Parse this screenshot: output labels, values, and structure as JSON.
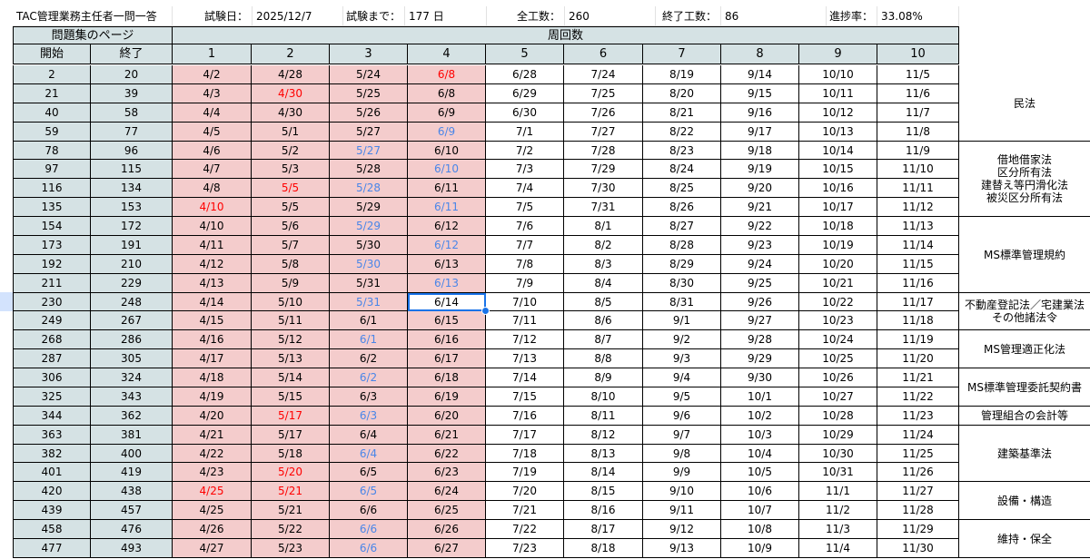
{
  "sheet_title": "TAC管理業務主任者一問一答",
  "summary": {
    "exam_date_label": "試験日：",
    "exam_date": "2025/12/7",
    "until_label": "試験まで：",
    "until_value": "177 日",
    "total_label": "全工数：",
    "total_value": "260",
    "done_label": "終了工数：",
    "done_value": "86",
    "progress_label": "進捗率：",
    "progress_value": "33.08%"
  },
  "headers": {
    "pages_group": "問題集のページ",
    "rounds_group": "周回数",
    "start": "開始",
    "end": "終了",
    "rounds": [
      "1",
      "2",
      "3",
      "4",
      "5",
      "6",
      "7",
      "8",
      "9",
      "10"
    ]
  },
  "rows": [
    {
      "pages": [
        "2",
        "20"
      ],
      "dates": [
        "4/2",
        "4/28",
        "5/24",
        "6/8",
        "6/28",
        "7/24",
        "8/19",
        "9/14",
        "10/10",
        "11/5"
      ],
      "colors": [
        "",
        "",
        "",
        "r",
        "",
        "",
        "",
        "",
        "",
        ""
      ]
    },
    {
      "pages": [
        "21",
        "39"
      ],
      "dates": [
        "4/3",
        "4/30",
        "5/25",
        "6/8",
        "6/29",
        "7/25",
        "8/20",
        "9/15",
        "10/11",
        "11/6"
      ],
      "colors": [
        "",
        "r",
        "",
        "",
        "",
        "",
        "",
        "",
        "",
        ""
      ]
    },
    {
      "pages": [
        "40",
        "58"
      ],
      "dates": [
        "4/4",
        "4/30",
        "5/26",
        "6/9",
        "6/30",
        "7/26",
        "8/21",
        "9/16",
        "10/12",
        "11/7"
      ],
      "colors": [
        "",
        "",
        "",
        "",
        "",
        "",
        "",
        "",
        "",
        ""
      ]
    },
    {
      "pages": [
        "59",
        "77"
      ],
      "dates": [
        "4/5",
        "5/1",
        "5/27",
        "6/9",
        "7/1",
        "7/27",
        "8/22",
        "9/17",
        "10/13",
        "11/8"
      ],
      "colors": [
        "",
        "",
        "",
        "b",
        "",
        "",
        "",
        "",
        "",
        ""
      ]
    },
    {
      "pages": [
        "78",
        "96"
      ],
      "dates": [
        "4/6",
        "5/2",
        "5/27",
        "6/10",
        "7/2",
        "7/28",
        "8/23",
        "9/18",
        "10/14",
        "11/9"
      ],
      "colors": [
        "",
        "",
        "b",
        "",
        "",
        "",
        "",
        "",
        "",
        ""
      ]
    },
    {
      "pages": [
        "97",
        "115"
      ],
      "dates": [
        "4/7",
        "5/3",
        "5/28",
        "6/10",
        "7/3",
        "7/29",
        "8/24",
        "9/19",
        "10/15",
        "11/10"
      ],
      "colors": [
        "",
        "",
        "",
        "b",
        "",
        "",
        "",
        "",
        "",
        ""
      ]
    },
    {
      "pages": [
        "116",
        "134"
      ],
      "dates": [
        "4/8",
        "5/5",
        "5/28",
        "6/11",
        "7/4",
        "7/30",
        "8/25",
        "9/20",
        "10/16",
        "11/11"
      ],
      "colors": [
        "",
        "r",
        "b",
        "",
        "",
        "",
        "",
        "",
        "",
        ""
      ]
    },
    {
      "pages": [
        "135",
        "153"
      ],
      "dates": [
        "4/10",
        "5/5",
        "5/29",
        "6/11",
        "7/5",
        "7/31",
        "8/26",
        "9/21",
        "10/17",
        "11/12"
      ],
      "colors": [
        "r",
        "",
        "",
        "b",
        "",
        "",
        "",
        "",
        "",
        ""
      ]
    },
    {
      "pages": [
        "154",
        "172"
      ],
      "dates": [
        "4/10",
        "5/6",
        "5/29",
        "6/12",
        "7/6",
        "8/1",
        "8/27",
        "9/22",
        "10/18",
        "11/13"
      ],
      "colors": [
        "",
        "",
        "b",
        "",
        "",
        "",
        "",
        "",
        "",
        ""
      ]
    },
    {
      "pages": [
        "173",
        "191"
      ],
      "dates": [
        "4/11",
        "5/7",
        "5/30",
        "6/12",
        "7/7",
        "8/2",
        "8/28",
        "9/23",
        "10/19",
        "11/14"
      ],
      "colors": [
        "",
        "",
        "",
        "b",
        "",
        "",
        "",
        "",
        "",
        ""
      ]
    },
    {
      "pages": [
        "192",
        "210"
      ],
      "dates": [
        "4/12",
        "5/8",
        "5/30",
        "6/13",
        "7/8",
        "8/3",
        "8/29",
        "9/24",
        "10/20",
        "11/15"
      ],
      "colors": [
        "",
        "",
        "b",
        "",
        "",
        "",
        "",
        "",
        "",
        ""
      ]
    },
    {
      "pages": [
        "211",
        "229"
      ],
      "dates": [
        "4/13",
        "5/9",
        "5/31",
        "6/13",
        "7/9",
        "8/4",
        "8/30",
        "9/25",
        "10/21",
        "11/16"
      ],
      "colors": [
        "",
        "",
        "",
        "b",
        "",
        "",
        "",
        "",
        "",
        ""
      ]
    },
    {
      "pages": [
        "230",
        "248"
      ],
      "dates": [
        "4/14",
        "5/10",
        "5/31",
        "6/14",
        "7/10",
        "8/5",
        "8/31",
        "9/26",
        "10/22",
        "11/17"
      ],
      "colors": [
        "",
        "",
        "b",
        "",
        "",
        "",
        "",
        "",
        "",
        ""
      ]
    },
    {
      "pages": [
        "249",
        "267"
      ],
      "dates": [
        "4/15",
        "5/11",
        "6/1",
        "6/15",
        "7/11",
        "8/6",
        "9/1",
        "9/27",
        "10/23",
        "11/18"
      ],
      "colors": [
        "",
        "",
        "",
        "",
        "",
        "",
        "",
        "",
        "",
        ""
      ]
    },
    {
      "pages": [
        "268",
        "286"
      ],
      "dates": [
        "4/16",
        "5/12",
        "6/1",
        "6/16",
        "7/12",
        "8/7",
        "9/2",
        "9/28",
        "10/24",
        "11/19"
      ],
      "colors": [
        "",
        "",
        "b",
        "",
        "",
        "",
        "",
        "",
        "",
        ""
      ]
    },
    {
      "pages": [
        "287",
        "305"
      ],
      "dates": [
        "4/17",
        "5/13",
        "6/2",
        "6/17",
        "7/13",
        "8/8",
        "9/3",
        "9/29",
        "10/25",
        "11/20"
      ],
      "colors": [
        "",
        "",
        "",
        "",
        "",
        "",
        "",
        "",
        "",
        ""
      ]
    },
    {
      "pages": [
        "306",
        "324"
      ],
      "dates": [
        "4/18",
        "5/14",
        "6/2",
        "6/18",
        "7/14",
        "8/9",
        "9/4",
        "9/30",
        "10/26",
        "11/21"
      ],
      "colors": [
        "",
        "",
        "b",
        "",
        "",
        "",
        "",
        "",
        "",
        ""
      ]
    },
    {
      "pages": [
        "325",
        "343"
      ],
      "dates": [
        "4/19",
        "5/15",
        "6/3",
        "6/19",
        "7/15",
        "8/10",
        "9/5",
        "10/1",
        "10/27",
        "11/22"
      ],
      "colors": [
        "",
        "",
        "",
        "",
        "",
        "",
        "",
        "",
        "",
        ""
      ]
    },
    {
      "pages": [
        "344",
        "362"
      ],
      "dates": [
        "4/20",
        "5/17",
        "6/3",
        "6/20",
        "7/16",
        "8/11",
        "9/6",
        "10/2",
        "10/28",
        "11/23"
      ],
      "colors": [
        "",
        "r",
        "b",
        "",
        "",
        "",
        "",
        "",
        "",
        ""
      ]
    },
    {
      "pages": [
        "363",
        "381"
      ],
      "dates": [
        "4/21",
        "5/17",
        "6/4",
        "6/21",
        "7/17",
        "8/12",
        "9/7",
        "10/3",
        "10/29",
        "11/24"
      ],
      "colors": [
        "",
        "",
        "",
        "",
        "",
        "",
        "",
        "",
        "",
        ""
      ]
    },
    {
      "pages": [
        "382",
        "400"
      ],
      "dates": [
        "4/22",
        "5/18",
        "6/4",
        "6/22",
        "7/18",
        "8/13",
        "9/8",
        "10/4",
        "10/30",
        "11/25"
      ],
      "colors": [
        "",
        "",
        "b",
        "",
        "",
        "",
        "",
        "",
        "",
        ""
      ]
    },
    {
      "pages": [
        "401",
        "419"
      ],
      "dates": [
        "4/23",
        "5/20",
        "6/5",
        "6/23",
        "7/19",
        "8/14",
        "9/9",
        "10/5",
        "10/31",
        "11/26"
      ],
      "colors": [
        "",
        "r",
        "",
        "",
        "",
        "",
        "",
        "",
        "",
        ""
      ]
    },
    {
      "pages": [
        "420",
        "438"
      ],
      "dates": [
        "4/25",
        "5/21",
        "6/5",
        "6/24",
        "7/20",
        "8/15",
        "9/10",
        "10/6",
        "11/1",
        "11/27"
      ],
      "colors": [
        "r",
        "r",
        "b",
        "",
        "",
        "",
        "",
        "",
        "",
        ""
      ]
    },
    {
      "pages": [
        "439",
        "457"
      ],
      "dates": [
        "4/25",
        "5/21",
        "6/6",
        "6/25",
        "7/21",
        "8/16",
        "9/11",
        "10/7",
        "11/2",
        "11/28"
      ],
      "colors": [
        "",
        "",
        "",
        "",
        "",
        "",
        "",
        "",
        "",
        ""
      ]
    },
    {
      "pages": [
        "458",
        "476"
      ],
      "dates": [
        "4/26",
        "5/22",
        "6/6",
        "6/26",
        "7/22",
        "8/17",
        "9/12",
        "10/8",
        "11/3",
        "11/29"
      ],
      "colors": [
        "",
        "",
        "b",
        "",
        "",
        "",
        "",
        "",
        "",
        ""
      ]
    },
    {
      "pages": [
        "477",
        "493"
      ],
      "dates": [
        "4/27",
        "5/23",
        "6/6",
        "6/27",
        "7/23",
        "8/18",
        "9/13",
        "10/9",
        "11/4",
        "11/30"
      ],
      "colors": [
        "",
        "",
        "b",
        "",
        "",
        "",
        "",
        "",
        "",
        ""
      ]
    }
  ],
  "subjects": [
    {
      "lines": [
        "民法"
      ]
    },
    {
      "lines": [
        "借地借家法",
        "区分所有法",
        "建替え等円滑化法",
        "被災区分所有法"
      ]
    },
    {
      "lines": [
        "MS標準管理規約"
      ]
    },
    {
      "lines": [
        "不動産登記法／宅建業法",
        "その他諸法令"
      ]
    },
    {
      "lines": [
        "MS管理適正化法"
      ]
    },
    {
      "lines": [
        "MS標準管理委託契約書"
      ]
    },
    {
      "lines": [
        "管理組合の会計等"
      ]
    },
    {
      "lines": [
        "建築基準法"
      ]
    },
    {
      "lines": [
        "設備・構造"
      ]
    },
    {
      "lines": [
        "維持・保全"
      ]
    }
  ],
  "selected_cell": "6/14",
  "colors": {
    "header_bg": "#d5e2e4",
    "pink_bg": "#f4cccc",
    "red_text": "#ff0000",
    "blue_text": "#4a86e8",
    "selection": "#1a73e8"
  }
}
